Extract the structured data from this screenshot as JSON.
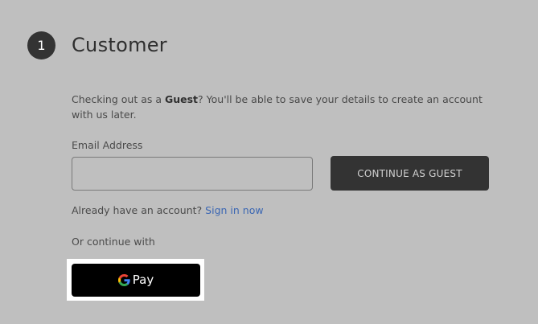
{
  "step": {
    "number": "1",
    "title": "Customer"
  },
  "guest_notice": {
    "prefix": "Checking out as a ",
    "bold": "Guest",
    "suffix": "? You'll be able to save your details to create an account with us later."
  },
  "email": {
    "label": "Email Address",
    "value": "",
    "placeholder": ""
  },
  "continue_button": {
    "label": "CONTINUE AS GUEST"
  },
  "signin": {
    "prompt": "Already have an account?",
    "link": "Sign in now"
  },
  "alt_payment": {
    "label": "Or continue with",
    "gpay_text": "Pay",
    "gpay_icon": "google-g-icon"
  },
  "colors": {
    "background": "#bfbfbf",
    "dark": "#333333",
    "link": "#3b67b3"
  }
}
